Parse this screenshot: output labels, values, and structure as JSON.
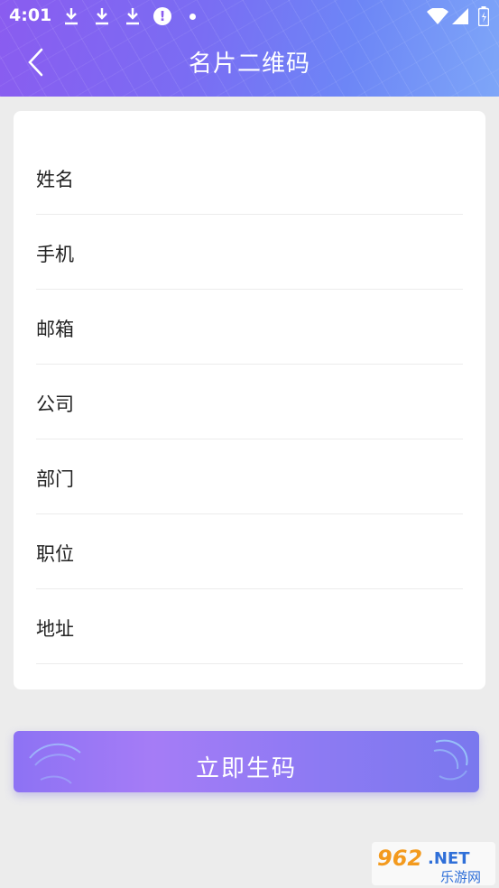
{
  "status_bar": {
    "time": "4:01",
    "alert_glyph": "!",
    "icons": [
      "download-icon",
      "download-icon",
      "download-icon",
      "alert-icon",
      "dot-icon",
      "wifi-icon",
      "signal-icon",
      "battery-icon"
    ]
  },
  "header": {
    "title": "名片二维码",
    "back_icon": "chevron-left-icon"
  },
  "form": {
    "fields": [
      {
        "label": "姓名",
        "value": "",
        "placeholder": ""
      },
      {
        "label": "手机",
        "value": "",
        "placeholder": ""
      },
      {
        "label": "邮箱",
        "value": "",
        "placeholder": ""
      },
      {
        "label": "公司",
        "value": "",
        "placeholder": ""
      },
      {
        "label": "部门",
        "value": "",
        "placeholder": ""
      },
      {
        "label": "职位",
        "value": "",
        "placeholder": ""
      },
      {
        "label": "地址",
        "value": "",
        "placeholder": ""
      }
    ]
  },
  "submit": {
    "label": "立即生码"
  },
  "watermark": {
    "number": "962",
    "suffix": ".NET",
    "sub": "乐游网"
  },
  "colors": {
    "header_gradient_start": "#8a5cf0",
    "header_gradient_end": "#7ea6f8",
    "button_gradient_start": "#8d72f4",
    "button_gradient_end": "#7a78ee",
    "background": "#ececec"
  }
}
